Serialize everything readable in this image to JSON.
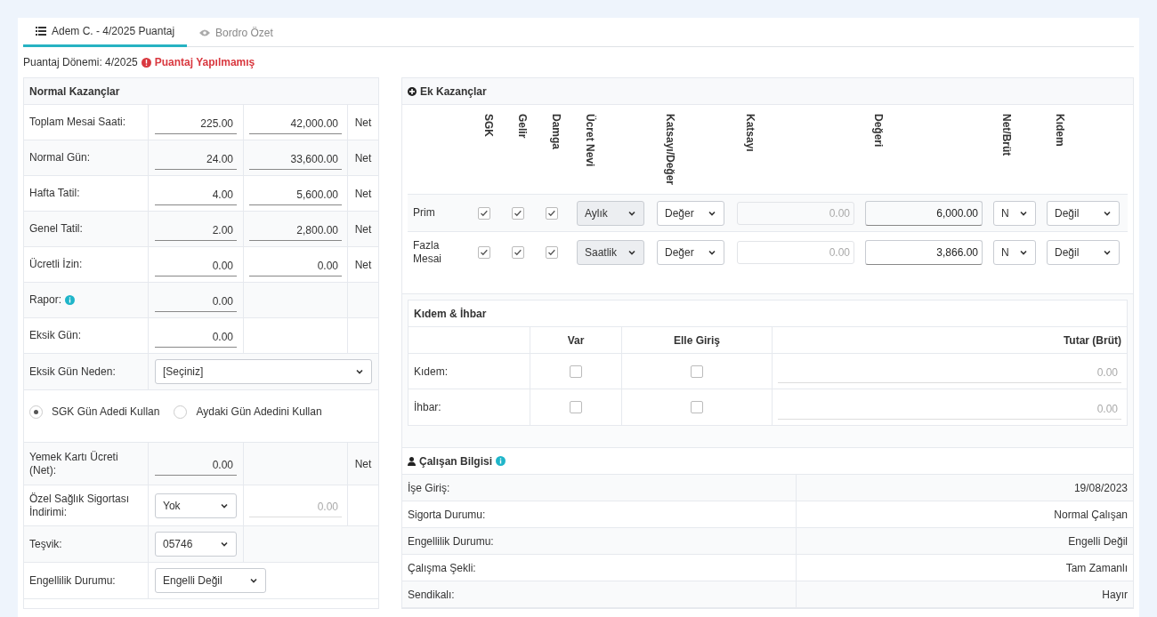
{
  "tabs": [
    {
      "label": "Adem C. - 4/2025 Puantaj",
      "kind": "list",
      "selected": true
    },
    {
      "label": "Bordro Özet",
      "kind": "eye",
      "selected": false
    }
  ],
  "period": {
    "label": "Puantaj Dönemi: 4/2025",
    "status": "Puantaj Yapılmamış"
  },
  "normal_earnings": {
    "title": "Normal Kazançlar",
    "rows": [
      {
        "kind": "pair",
        "label": "Toplam Mesai Saati:",
        "value": "225.00",
        "amount": "42,000.00",
        "unit": "Net"
      },
      {
        "kind": "pair",
        "label": "Normal Gün:",
        "value": "24.00",
        "amount": "33,600.00",
        "unit": "Net"
      },
      {
        "kind": "pair",
        "label": "Hafta Tatil:",
        "value": "4.00",
        "amount": "5,600.00",
        "unit": "Net"
      },
      {
        "kind": "pair",
        "label": "Genel Tatil:",
        "value": "2.00",
        "amount": "2,800.00",
        "unit": "Net"
      },
      {
        "kind": "pair",
        "label": "Ücretli İzin:",
        "value": "0.00",
        "amount": "0.00",
        "unit": "Net"
      },
      {
        "kind": "single",
        "label": "Rapor:",
        "info": true,
        "value": "0.00"
      },
      {
        "kind": "single",
        "label": "Eksik Gün:",
        "value": "0.00"
      },
      {
        "kind": "wide_select",
        "label": "Eksik Gün Neden:",
        "select": "[Seçiniz]"
      },
      {
        "kind": "radio",
        "options": [
          {
            "label": "SGK Gün Adedi Kullan",
            "selected": true
          },
          {
            "label": "Aydaki Gün Adedini Kullan",
            "selected": false
          }
        ]
      },
      {
        "kind": "value_unit",
        "label": "Yemek Kartı Ücreti (Net):",
        "value": "0.00",
        "unit": "Net"
      },
      {
        "kind": "select_amount",
        "label": "Özel Sağlık Sigortası İndirimi:",
        "select": "Yok",
        "amount": "0.00"
      },
      {
        "kind": "select",
        "label": "Teşvik:",
        "select": "05746"
      },
      {
        "kind": "select",
        "label": "Engellilik Durumu:",
        "select": "Engelli Değil"
      }
    ]
  },
  "extra_earnings": {
    "title": "Ek Kazançlar",
    "columns": [
      "SGK",
      "Gelir",
      "Damga",
      "Ücret Nevi",
      "Katsayı/Değer",
      "Katsayı",
      "Değeri",
      "Net/Brüt",
      "Kıdem"
    ],
    "rows": [
      {
        "label": "Prim",
        "checks": [
          true,
          true,
          true
        ],
        "wage_type": "Aylık",
        "factor_or_value": "Değer",
        "factor": "0.00",
        "value": "6,000.00",
        "net_gross": "N",
        "severance": "Değil"
      },
      {
        "label": "Fazla Mesai",
        "checks": [
          true,
          true,
          true
        ],
        "wage_type": "Saatlik",
        "factor_or_value": "Değer",
        "factor": "0.00",
        "value": "3,866.00",
        "net_gross": "N",
        "severance": "Değil"
      }
    ]
  },
  "severance_notice": {
    "title": "Kıdem & İhbar",
    "columns": [
      "Var",
      "Elle Giriş",
      "Tutar (Brüt)"
    ],
    "rows": [
      {
        "label": "Kıdem:",
        "exists": false,
        "manual": false,
        "amount": "0.00"
      },
      {
        "label": "İhbar:",
        "exists": false,
        "manual": false,
        "amount": "0.00"
      }
    ]
  },
  "employee_info": {
    "title": "Çalışan Bilgisi",
    "info": true,
    "rows": [
      {
        "label": "İşe Giriş:",
        "value": "19/08/2023"
      },
      {
        "label": "Sigorta Durumu:",
        "value": "Normal Çalışan"
      },
      {
        "label": "Engellilik Durumu:",
        "value": "Engelli Değil"
      },
      {
        "label": "Çalışma Şekli:",
        "value": "Tam Zamanlı"
      },
      {
        "label": "Sendikalı:",
        "value": "Hayır"
      }
    ]
  }
}
